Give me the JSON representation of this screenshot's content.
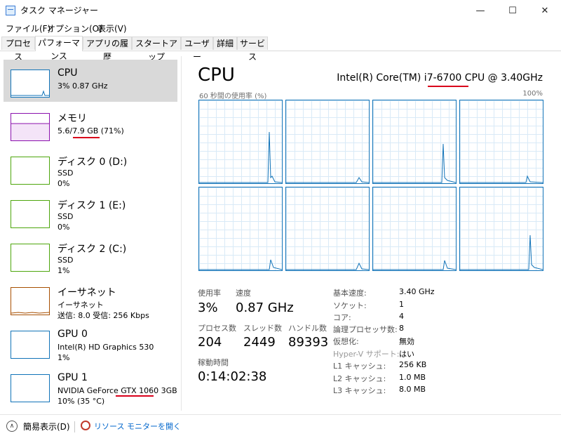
{
  "window": {
    "title": "タスク マネージャー",
    "minimize": "—",
    "maximize": "☐",
    "close": "✕"
  },
  "menu": [
    "ファイル(F)",
    "オプション(O)",
    "表示(V)"
  ],
  "tabs": [
    "プロセス",
    "パフォーマンス",
    "アプリの履歴",
    "スタートアップ",
    "ユーザー",
    "詳細",
    "サービス"
  ],
  "active_tab": "パフォーマンス",
  "sidebar": {
    "items": [
      {
        "name": "CPU",
        "l1": "3%  0.87 GHz",
        "l2": "",
        "color": "#1173b8"
      },
      {
        "name": "メモリ",
        "l1": "5.6/7.9 GB (71%)",
        "l2": "",
        "color": "#8b12ae"
      },
      {
        "name": "ディスク 0 (D:)",
        "l1": "SSD",
        "l2": "0%",
        "color": "#4da60c"
      },
      {
        "name": "ディスク 1 (E:)",
        "l1": "SSD",
        "l2": "0%",
        "color": "#4da60c"
      },
      {
        "name": "ディスク 2 (C:)",
        "l1": "SSD",
        "l2": "1%",
        "color": "#4da60c"
      },
      {
        "name": "イーサネット",
        "l1": "イーサネット",
        "l2": "送信: 8.0 受信: 256 Kbps",
        "color": "#a74f01"
      },
      {
        "name": "GPU 0",
        "l1": "Intel(R) HD Graphics 530",
        "l2": "1%",
        "color": "#1173b8"
      },
      {
        "name": "GPU 1",
        "l1": "NVIDIA GeForce GTX 1060 3GB",
        "l2": "10% (35 °C)",
        "color": "#1173b8"
      }
    ]
  },
  "main": {
    "title": "CPU",
    "model": "Intel(R) Core(TM) i7-6700 CPU @ 3.40GHz",
    "graph_caption_left": "60 秒間の使用率 (%)",
    "graph_caption_right": "100%",
    "stats": {
      "usage_label": "使用率",
      "usage": "3%",
      "speed_label": "速度",
      "speed": "0.87 GHz",
      "proc_label": "プロセス数",
      "proc": "204",
      "thread_label": "スレッド数",
      "thread": "2449",
      "handle_label": "ハンドル数",
      "handle": "89393",
      "uptime_label": "稼動時間",
      "uptime": "0:14:02:38"
    },
    "specs": [
      {
        "k": "基本速度:",
        "v": "3.40 GHz"
      },
      {
        "k": "ソケット:",
        "v": "1"
      },
      {
        "k": "コア:",
        "v": "4"
      },
      {
        "k": "論理プロセッサ数:",
        "v": "8"
      },
      {
        "k": "仮想化:",
        "v": "無効"
      },
      {
        "k": "Hyper-V サポート:",
        "v": "はい"
      },
      {
        "k": "L1 キャッシュ:",
        "v": "256 KB"
      },
      {
        "k": "L2 キャッシュ:",
        "v": "1.0 MB"
      },
      {
        "k": "L3 キャッシュ:",
        "v": "8.0 MB"
      }
    ]
  },
  "footer": {
    "fewer": "簡易表示(D)",
    "resource_monitor": "リソース モニターを開く"
  }
}
